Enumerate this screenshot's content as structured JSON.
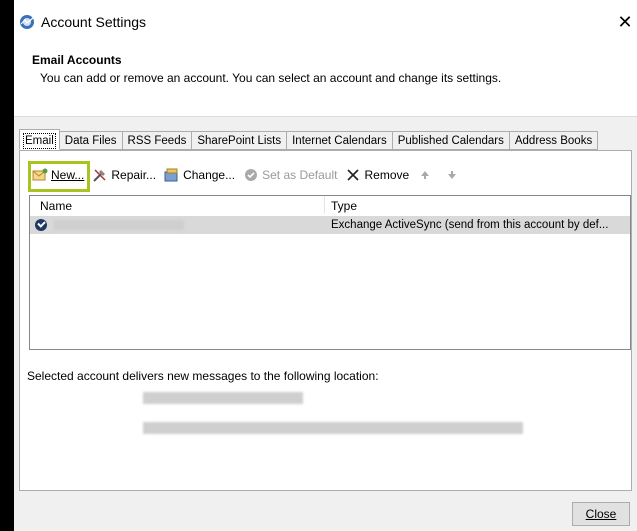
{
  "window": {
    "title": "Account Settings",
    "close_glyph": "✕"
  },
  "header": {
    "title": "Email Accounts",
    "description": "You can add or remove an account. You can select an account and change its settings."
  },
  "tabs": [
    {
      "label": "Email",
      "active": true
    },
    {
      "label": "Data Files"
    },
    {
      "label": "RSS Feeds"
    },
    {
      "label": "SharePoint Lists"
    },
    {
      "label": "Internet Calendars"
    },
    {
      "label": "Published Calendars"
    },
    {
      "label": "Address Books"
    }
  ],
  "toolbar": {
    "new_label": "New...",
    "repair_label": "Repair...",
    "change_label": "Change...",
    "set_default_label": "Set as Default",
    "remove_label": "Remove"
  },
  "list": {
    "columns": [
      "Name",
      "Type"
    ],
    "rows": [
      {
        "name": "",
        "type": "Exchange ActiveSync (send from this account by def..."
      }
    ]
  },
  "deliver_text": "Selected account delivers new messages to the following location:",
  "footer": {
    "close_label": "Close"
  },
  "colors": {
    "highlight": "#a7c51e",
    "selected_row": "#d9d9d9"
  }
}
